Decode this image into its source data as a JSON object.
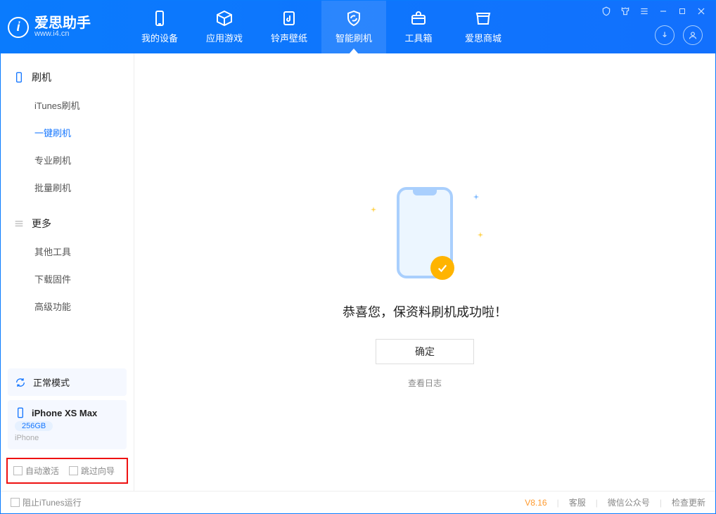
{
  "app": {
    "name": "爱思助手",
    "sub": "www.i4.cn"
  },
  "tabs": {
    "device": "我的设备",
    "apps": "应用游戏",
    "ringtone": "铃声壁纸",
    "flash": "智能刷机",
    "toolbox": "工具箱",
    "store": "爱思商城"
  },
  "sidebar": {
    "group_flash": "刷机",
    "itunes_flash": "iTunes刷机",
    "one_click_flash": "一键刷机",
    "pro_flash": "专业刷机",
    "batch_flash": "批量刷机",
    "group_more": "更多",
    "other_tools": "其他工具",
    "download_fw": "下载固件",
    "advanced": "高级功能",
    "normal_mode": "正常模式",
    "phone_model": "iPhone XS Max",
    "phone_storage": "256GB",
    "phone_type": "iPhone",
    "auto_activate": "自动激活",
    "skip_wizard": "跳过向导"
  },
  "main": {
    "success_title": "恭喜您，保资料刷机成功啦！",
    "confirm": "确定",
    "view_log": "查看日志"
  },
  "footer": {
    "block_itunes": "阻止iTunes运行",
    "version": "V8.16",
    "cs": "客服",
    "wechat": "微信公众号",
    "update": "检查更新"
  }
}
